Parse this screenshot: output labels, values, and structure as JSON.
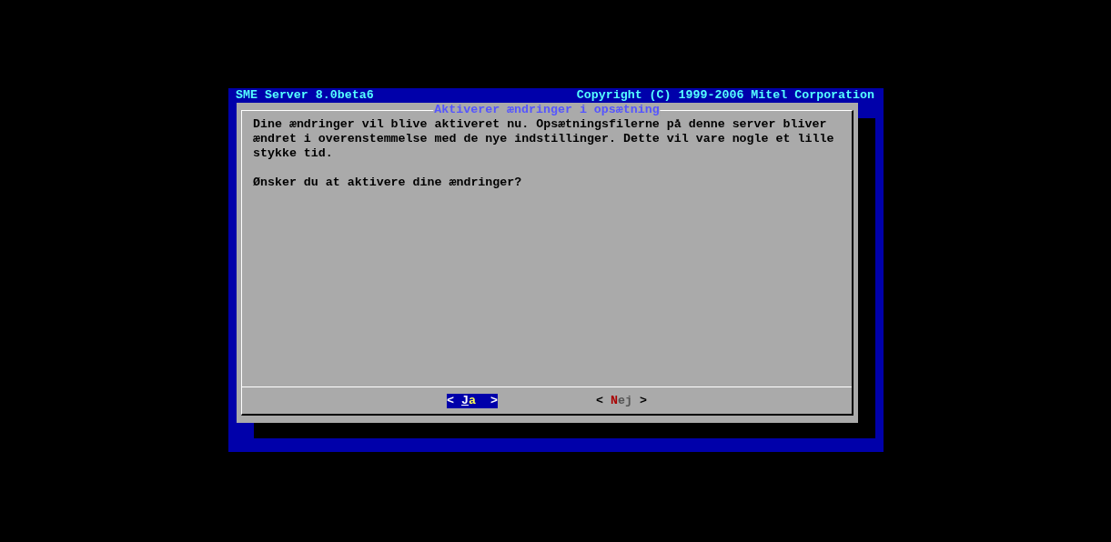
{
  "header": {
    "title": "SME Server 8.0beta6",
    "copyright": "Copyright (C) 1999-2006 Mitel Corporation"
  },
  "dialog": {
    "title": "Aktiverer ændringer i opsætning",
    "paragraphs": [
      "Dine ændringer vil blive aktiveret nu. Opsætningsfilerne på denne server bliver ændret i overenstemmelse med de nye indstillinger. Dette vil vare nogle et lille stykke tid.",
      "Ønsker du at aktivere dine ændringer?"
    ],
    "buttons": [
      {
        "left": "<",
        "label": "Ja",
        "right": ">",
        "selected": true
      },
      {
        "left": "<",
        "label": "Nej",
        "right": ">",
        "selected": false
      }
    ]
  }
}
